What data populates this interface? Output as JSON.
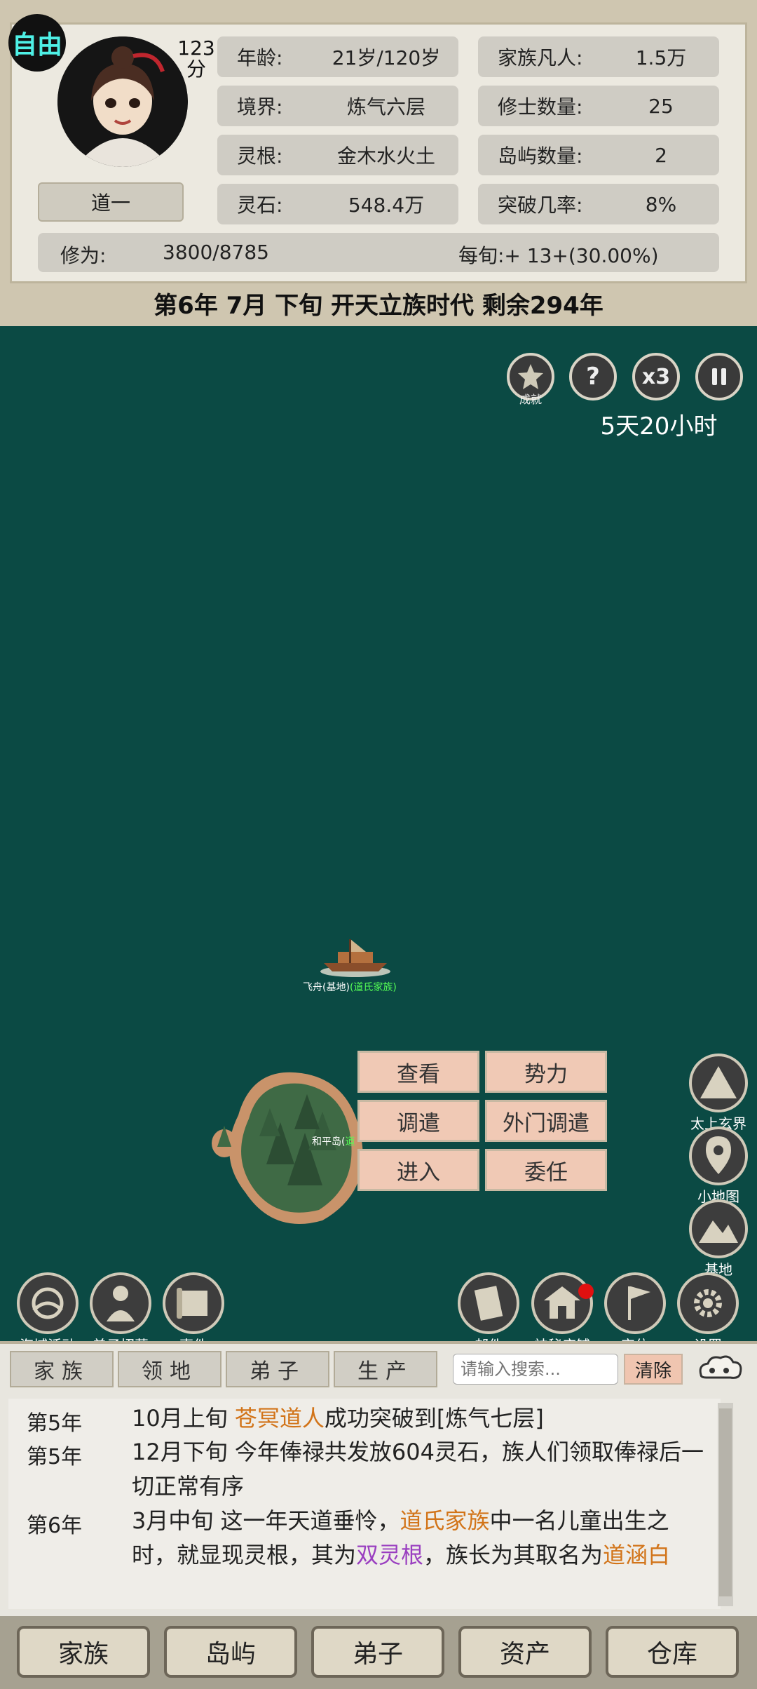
{
  "header": {
    "free_badge": "自由",
    "score_value": "123",
    "score_unit": "分",
    "player_name": "道一",
    "stats_left": [
      {
        "label": "年龄:",
        "value": "21岁/120岁"
      },
      {
        "label": "境界:",
        "value": "炼气六层"
      },
      {
        "label": "灵根:",
        "value": "金木水火土"
      },
      {
        "label": "灵石:",
        "value": "548.4万"
      }
    ],
    "stats_right": [
      {
        "label": "家族凡人:",
        "value": "1.5万"
      },
      {
        "label": "修士数量:",
        "value": "25"
      },
      {
        "label": "岛屿数量:",
        "value": "2"
      },
      {
        "label": "突破几率:",
        "value": "8%"
      }
    ],
    "cultivation_label": "修为:",
    "cultivation_value": "3800/8785",
    "per_period": "每旬:+ 13+(30.00%)",
    "date_line": "第6年 7月 下旬  开天立族时代 剩余294年"
  },
  "map_controls": {
    "achievement_label": "成就",
    "help_symbol": "?",
    "speed_label": "x3",
    "time_remaining": "5天20小时"
  },
  "map": {
    "ship_label": "飞舟(基地)",
    "ship_family": "(道氏家族)",
    "island_label": "和平岛(",
    "island_family": "道"
  },
  "context_menu": {
    "items": [
      "查看",
      "势力",
      "调遣",
      "外门调遣",
      "进入",
      "委任"
    ]
  },
  "side_buttons": [
    {
      "label": "太上玄界",
      "icon": "mountain-icon"
    },
    {
      "label": "小地图",
      "icon": "map-pin-icon"
    },
    {
      "label": "基地",
      "icon": "base-mountain-icon"
    }
  ],
  "bottom_left_buttons": [
    {
      "label": "海域活动",
      "icon": "sea-activity-icon"
    },
    {
      "label": "弟子招募",
      "icon": "disciple-icon"
    },
    {
      "label": "事件",
      "icon": "scroll-icon"
    }
  ],
  "bottom_right_buttons": [
    {
      "label": "邮件",
      "icon": "mail-icon"
    },
    {
      "label": "神秘店铺",
      "icon": "shop-icon"
    },
    {
      "label": "定位",
      "icon": "flag-icon"
    },
    {
      "label": "设置",
      "icon": "gear-icon"
    }
  ],
  "log": {
    "tabs": [
      "家族",
      "领地",
      "弟子",
      "生产"
    ],
    "search_placeholder": "请输入搜索...",
    "clear_label": "清除",
    "entries": [
      {
        "year": "第5年",
        "pre": "10月上旬 ",
        "hl1": "苍冥道人",
        "mid": "成功突破到[炼气七层]",
        "hl2": "",
        "post": "",
        "hl3": "",
        "tail": ""
      },
      {
        "year": "第5年",
        "pre": "12月下旬 今年俸禄共发放604灵石，族人们领取俸禄后一切正常有序",
        "hl1": "",
        "mid": "",
        "hl2": "",
        "post": "",
        "hl3": "",
        "tail": ""
      },
      {
        "year": "第6年",
        "pre": "3月中旬 这一年天道垂怜，",
        "hl1": "道氏家族",
        "mid": "中一名儿童出生之时，就显现灵根，其为",
        "hl2": "双灵根",
        "post": "，族长为其取名为",
        "hl3": "道涵白",
        "tail": ""
      }
    ]
  },
  "bottom_nav": [
    "家族",
    "岛屿",
    "弟子",
    "资产",
    "仓库"
  ],
  "colors": {
    "sea": "#0b4a44",
    "panel": "#ece9e0",
    "highlight_orange": "#d27419",
    "highlight_purple": "#9a3fc0",
    "free_badge_text": "#4ef0e6"
  }
}
